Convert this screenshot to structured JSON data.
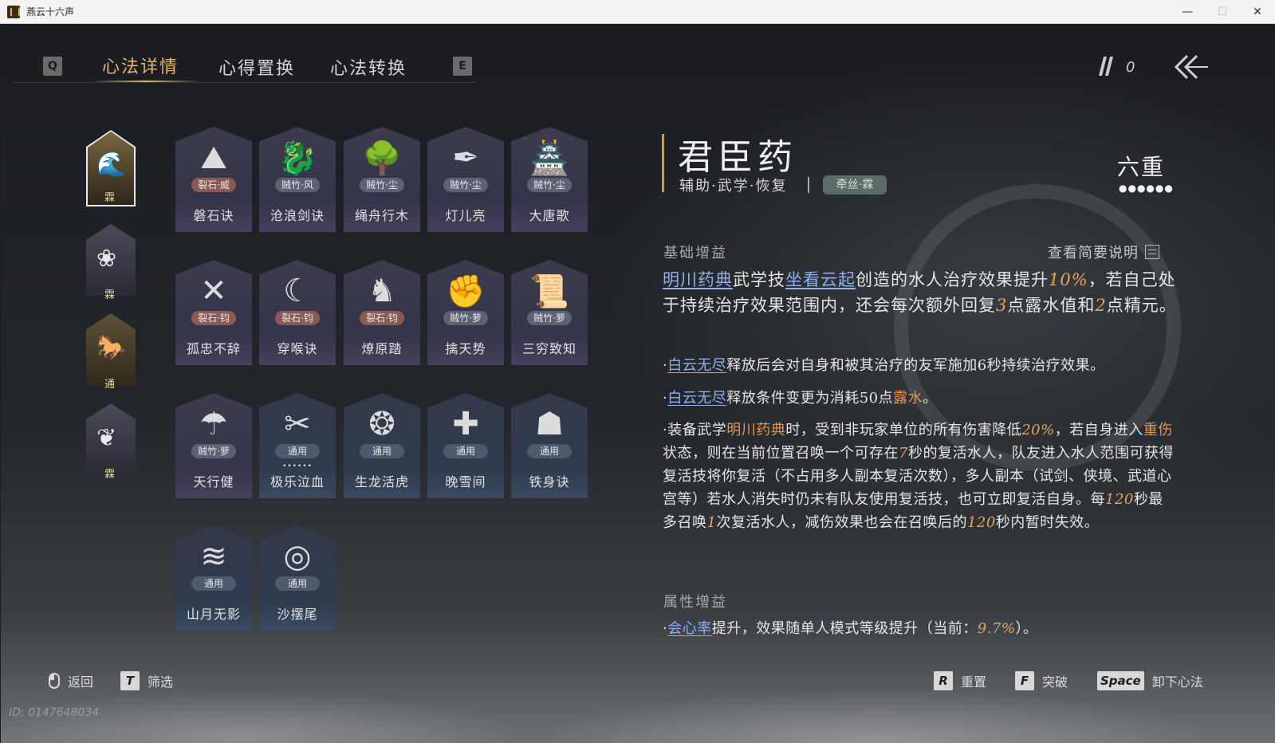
{
  "window": {
    "title": "燕云十六声",
    "minimize": "—",
    "maximize": "☐",
    "close": "✕"
  },
  "tabs": {
    "prev_key": "Q",
    "next_key": "E",
    "items": [
      {
        "label": "心法详情",
        "active": true
      },
      {
        "label": "心得置换",
        "active": false
      },
      {
        "label": "心法转换",
        "active": false
      }
    ]
  },
  "currency": {
    "value": "0",
    "icon": "feather-icon"
  },
  "side_tabs": [
    {
      "label": "霖",
      "glyph": "🌊"
    },
    {
      "label": "霖",
      "glyph": "❀"
    },
    {
      "label": "通",
      "glyph": "🐎"
    },
    {
      "label": "霖",
      "glyph": "❦"
    }
  ],
  "skills": [
    {
      "name": "磐石诀",
      "school": "裂石·威",
      "glyph": "⛰",
      "style": "purple",
      "tag": "red"
    },
    {
      "name": "沧浪剑诀",
      "school": "贼竹·风",
      "glyph": "🐉",
      "style": "purple",
      "tag": "slate"
    },
    {
      "name": "绳舟行木",
      "school": "贼竹·尘",
      "glyph": "🌳",
      "style": "purple",
      "tag": "slate"
    },
    {
      "name": "灯儿亮",
      "school": "贼竹·尘",
      "glyph": "✒",
      "style": "purple",
      "tag": "slate"
    },
    {
      "name": "大唐歌",
      "school": "贼竹·尘",
      "glyph": "🏯",
      "style": "purple",
      "tag": "slate"
    },
    {
      "name": "孤忠不辞",
      "school": "裂石·钧",
      "glyph": "✕",
      "style": "purple",
      "tag": "red"
    },
    {
      "name": "穿喉诀",
      "school": "裂石·钧",
      "glyph": "☾",
      "style": "purple",
      "tag": "red"
    },
    {
      "name": "燎原踏",
      "school": "裂石·钧",
      "glyph": "♞",
      "style": "purple",
      "tag": "red"
    },
    {
      "name": "擒天势",
      "school": "贼竹·萝",
      "glyph": "✊",
      "style": "purple",
      "tag": "slate"
    },
    {
      "name": "三穷致知",
      "school": "贼竹·萝",
      "glyph": "📜",
      "style": "purple",
      "tag": "slate"
    },
    {
      "name": "天行健",
      "school": "贼竹·萝",
      "glyph": "☂",
      "style": "purple",
      "tag": "slate"
    },
    {
      "name": "极乐泣血",
      "school": "通用",
      "glyph": "✂",
      "style": "blue",
      "tag": "steel",
      "dots": "••••••"
    },
    {
      "name": "生龙活虎",
      "school": "通用",
      "glyph": "❂",
      "style": "blue",
      "tag": "steel"
    },
    {
      "name": "晚雪间",
      "school": "通用",
      "glyph": "✚",
      "style": "blue",
      "tag": "steel"
    },
    {
      "name": "铁身诀",
      "school": "通用",
      "glyph": "☗",
      "style": "blue",
      "tag": "steel"
    },
    {
      "name": "山月无影",
      "school": "通用",
      "glyph": "≋",
      "style": "blue",
      "tag": "steel"
    },
    {
      "name": "沙摆尾",
      "school": "通用",
      "glyph": "◎",
      "style": "blue",
      "tag": "steel"
    }
  ],
  "detail": {
    "title": "君臣药",
    "subtitle": "辅助·武学·恢复",
    "tag": "牵丝·霖",
    "level": "六重",
    "level_dots": "●●●●●●",
    "basic_head": "基础增益",
    "brief_label": "查看简要说明",
    "main_text": [
      {
        "t": "明川药典",
        "c": "blue"
      },
      {
        "t": "武学技",
        "c": ""
      },
      {
        "t": "坐看云起",
        "c": "blue"
      },
      {
        "t": "创造的水人治疗效果提升",
        "c": ""
      },
      {
        "t": "10%",
        "c": "gold"
      },
      {
        "t": "，若自己处于持续治疗效果范围内，还会每次额外回复",
        "c": ""
      },
      {
        "t": "3",
        "c": "gold"
      },
      {
        "t": "点露水值和",
        "c": ""
      },
      {
        "t": "2",
        "c": "gold"
      },
      {
        "t": "点精元。",
        "c": ""
      }
    ],
    "bullet1": [
      {
        "t": "·",
        "c": ""
      },
      {
        "t": "白云无尽",
        "c": "blue"
      },
      {
        "t": "释放后会对自身和被其治疗的友军施加6秒持续治疗效果。",
        "c": ""
      }
    ],
    "bullet2": [
      {
        "t": "·",
        "c": ""
      },
      {
        "t": "白云无尽",
        "c": "blue"
      },
      {
        "t": "释放条件变更为消耗50点",
        "c": ""
      },
      {
        "t": "露水",
        "c": "orange"
      },
      {
        "t": "。",
        "c": ""
      }
    ],
    "bullet3": [
      {
        "t": "·装备武学",
        "c": ""
      },
      {
        "t": "明川药典",
        "c": "orange"
      },
      {
        "t": "时，受到非玩家单位的所有伤害降低",
        "c": ""
      },
      {
        "t": "20%",
        "c": "gold"
      },
      {
        "t": "，若自身进入",
        "c": ""
      },
      {
        "t": "重伤",
        "c": "orange"
      },
      {
        "t": "状态，则在当前位置召唤一个可存在",
        "c": ""
      },
      {
        "t": "7",
        "c": "gold"
      },
      {
        "t": "秒的复活水人，队友进入水人范围可获得复活技将你复活（不占用多人副本复活次数），多人副本（试剑、侠境、武道心宫等）若水人消失时仍未有队友使用复活技，也可立即复活自身。每",
        "c": ""
      },
      {
        "t": "120",
        "c": "gold"
      },
      {
        "t": "秒最多召唤",
        "c": ""
      },
      {
        "t": "1",
        "c": "gold"
      },
      {
        "t": "次复活水人，减伤效果也会在召唤后的",
        "c": ""
      },
      {
        "t": "120",
        "c": "gold"
      },
      {
        "t": "秒内暂时失效。",
        "c": ""
      }
    ],
    "attr_head": "属性增益",
    "attr_line": [
      {
        "t": "·",
        "c": ""
      },
      {
        "t": "会心率",
        "c": "blue"
      },
      {
        "t": "提升，效果随单人模式等级提升（当前：",
        "c": ""
      },
      {
        "t": "9.7%",
        "c": "gold"
      },
      {
        "t": "）。",
        "c": ""
      }
    ]
  },
  "footer": {
    "back_label": "返回",
    "filter_key": "T",
    "filter_label": "筛选",
    "reset_key": "R",
    "reset_label": "重置",
    "break_key": "F",
    "break_label": "突破",
    "unload_key": "Space",
    "unload_label": "卸下心法"
  },
  "uid": "ID: 0147648034",
  "colors": {
    "accent_gold": "#e2b46a",
    "link_blue": "#8fb0ea",
    "num_gold": "#e2a85a",
    "keyword_orange": "#e8934a"
  }
}
